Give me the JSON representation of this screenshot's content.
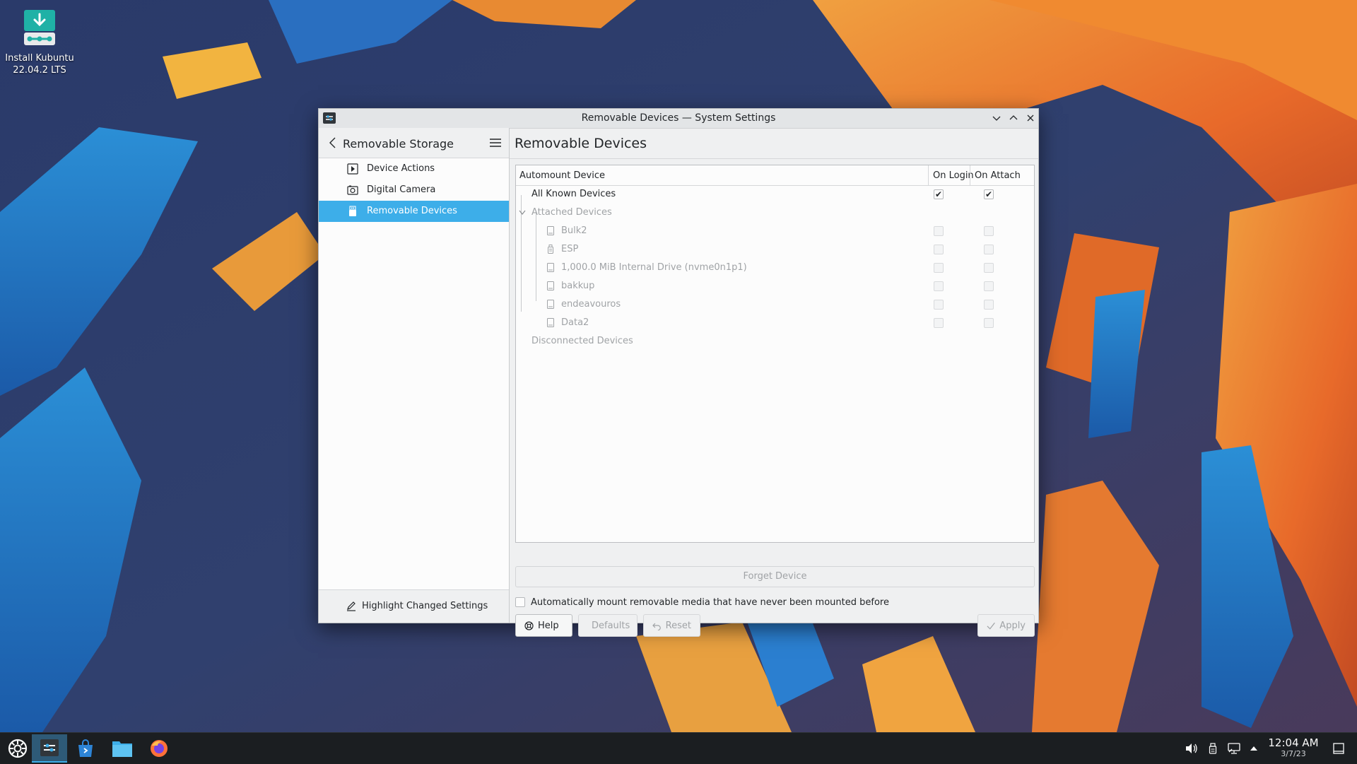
{
  "desktop": {
    "icon_label_line1": "Install Kubuntu",
    "icon_label_line2": "22.04.2 LTS",
    "icon_name": "download-install-icon"
  },
  "window": {
    "title": "Removable Devices — System Settings"
  },
  "sidebar": {
    "title": "Removable Storage",
    "items": [
      {
        "label": "Device Actions",
        "icon": "device-actions-icon",
        "selected": false
      },
      {
        "label": "Digital Camera",
        "icon": "digital-camera-icon",
        "selected": false
      },
      {
        "label": "Removable Devices",
        "icon": "removable-devices-icon",
        "selected": true
      }
    ],
    "footer_label": "Highlight Changed Settings"
  },
  "main": {
    "title": "Removable Devices",
    "columns": [
      "Automount Device",
      "On Login",
      "On Attach"
    ],
    "all_known": {
      "label": "All Known Devices",
      "on_login": true,
      "on_attach": true
    },
    "attached_group": "Attached Devices",
    "devices": [
      {
        "label": "Bulk2",
        "icon": "drive-icon",
        "on_login": false,
        "on_attach": false
      },
      {
        "label": "ESP",
        "icon": "usb-drive-icon",
        "on_login": false,
        "on_attach": false
      },
      {
        "label": "1,000.0 MiB Internal Drive (nvme0n1p1)",
        "icon": "drive-icon",
        "on_login": false,
        "on_attach": false
      },
      {
        "label": "bakkup",
        "icon": "drive-icon",
        "on_login": false,
        "on_attach": false
      },
      {
        "label": "endeavouros",
        "icon": "drive-icon",
        "on_login": false,
        "on_attach": false
      },
      {
        "label": "Data2",
        "icon": "drive-icon",
        "on_login": false,
        "on_attach": false
      }
    ],
    "disconnected_group": "Disconnected Devices",
    "forget_label": "Forget Device",
    "auto_mount_label": "Automatically mount removable media that have never been mounted before",
    "auto_mount_checked": false,
    "buttons": {
      "help": "Help",
      "defaults": "Defaults",
      "reset": "Reset",
      "apply": "Apply"
    }
  },
  "taskbar": {
    "time": "12:04 AM",
    "date": "3/7/23"
  },
  "colors": {
    "accent": "#3daee9",
    "window_bg": "#eff0f1",
    "view_bg": "#fcfcfc",
    "taskbar_bg": "#1b1e21"
  }
}
